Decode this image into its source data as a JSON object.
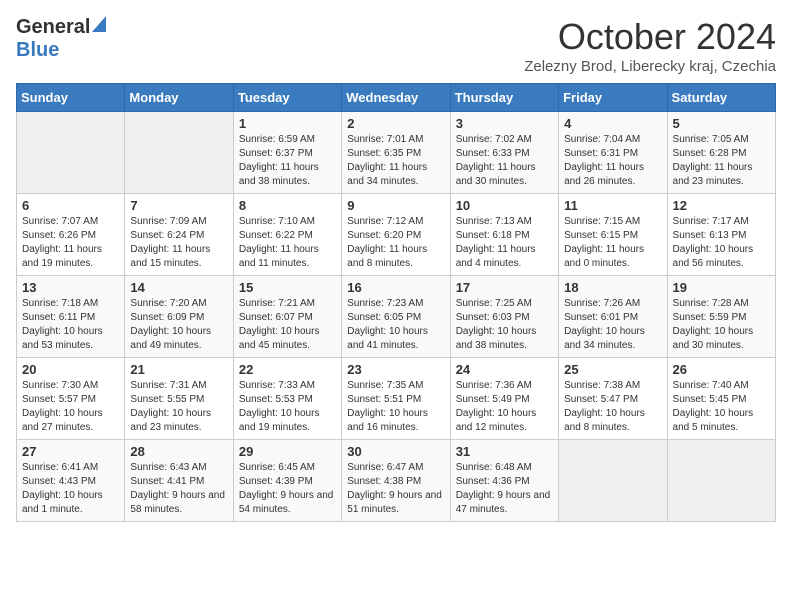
{
  "header": {
    "logo_general": "General",
    "logo_blue": "Blue",
    "month_title": "October 2024",
    "subtitle": "Zelezny Brod, Liberecky kraj, Czechia"
  },
  "days_of_week": [
    "Sunday",
    "Monday",
    "Tuesday",
    "Wednesday",
    "Thursday",
    "Friday",
    "Saturday"
  ],
  "weeks": [
    [
      {
        "day": "",
        "info": ""
      },
      {
        "day": "",
        "info": ""
      },
      {
        "day": "1",
        "info": "Sunrise: 6:59 AM\nSunset: 6:37 PM\nDaylight: 11 hours and 38 minutes."
      },
      {
        "day": "2",
        "info": "Sunrise: 7:01 AM\nSunset: 6:35 PM\nDaylight: 11 hours and 34 minutes."
      },
      {
        "day": "3",
        "info": "Sunrise: 7:02 AM\nSunset: 6:33 PM\nDaylight: 11 hours and 30 minutes."
      },
      {
        "day": "4",
        "info": "Sunrise: 7:04 AM\nSunset: 6:31 PM\nDaylight: 11 hours and 26 minutes."
      },
      {
        "day": "5",
        "info": "Sunrise: 7:05 AM\nSunset: 6:28 PM\nDaylight: 11 hours and 23 minutes."
      }
    ],
    [
      {
        "day": "6",
        "info": "Sunrise: 7:07 AM\nSunset: 6:26 PM\nDaylight: 11 hours and 19 minutes."
      },
      {
        "day": "7",
        "info": "Sunrise: 7:09 AM\nSunset: 6:24 PM\nDaylight: 11 hours and 15 minutes."
      },
      {
        "day": "8",
        "info": "Sunrise: 7:10 AM\nSunset: 6:22 PM\nDaylight: 11 hours and 11 minutes."
      },
      {
        "day": "9",
        "info": "Sunrise: 7:12 AM\nSunset: 6:20 PM\nDaylight: 11 hours and 8 minutes."
      },
      {
        "day": "10",
        "info": "Sunrise: 7:13 AM\nSunset: 6:18 PM\nDaylight: 11 hours and 4 minutes."
      },
      {
        "day": "11",
        "info": "Sunrise: 7:15 AM\nSunset: 6:15 PM\nDaylight: 11 hours and 0 minutes."
      },
      {
        "day": "12",
        "info": "Sunrise: 7:17 AM\nSunset: 6:13 PM\nDaylight: 10 hours and 56 minutes."
      }
    ],
    [
      {
        "day": "13",
        "info": "Sunrise: 7:18 AM\nSunset: 6:11 PM\nDaylight: 10 hours and 53 minutes."
      },
      {
        "day": "14",
        "info": "Sunrise: 7:20 AM\nSunset: 6:09 PM\nDaylight: 10 hours and 49 minutes."
      },
      {
        "day": "15",
        "info": "Sunrise: 7:21 AM\nSunset: 6:07 PM\nDaylight: 10 hours and 45 minutes."
      },
      {
        "day": "16",
        "info": "Sunrise: 7:23 AM\nSunset: 6:05 PM\nDaylight: 10 hours and 41 minutes."
      },
      {
        "day": "17",
        "info": "Sunrise: 7:25 AM\nSunset: 6:03 PM\nDaylight: 10 hours and 38 minutes."
      },
      {
        "day": "18",
        "info": "Sunrise: 7:26 AM\nSunset: 6:01 PM\nDaylight: 10 hours and 34 minutes."
      },
      {
        "day": "19",
        "info": "Sunrise: 7:28 AM\nSunset: 5:59 PM\nDaylight: 10 hours and 30 minutes."
      }
    ],
    [
      {
        "day": "20",
        "info": "Sunrise: 7:30 AM\nSunset: 5:57 PM\nDaylight: 10 hours and 27 minutes."
      },
      {
        "day": "21",
        "info": "Sunrise: 7:31 AM\nSunset: 5:55 PM\nDaylight: 10 hours and 23 minutes."
      },
      {
        "day": "22",
        "info": "Sunrise: 7:33 AM\nSunset: 5:53 PM\nDaylight: 10 hours and 19 minutes."
      },
      {
        "day": "23",
        "info": "Sunrise: 7:35 AM\nSunset: 5:51 PM\nDaylight: 10 hours and 16 minutes."
      },
      {
        "day": "24",
        "info": "Sunrise: 7:36 AM\nSunset: 5:49 PM\nDaylight: 10 hours and 12 minutes."
      },
      {
        "day": "25",
        "info": "Sunrise: 7:38 AM\nSunset: 5:47 PM\nDaylight: 10 hours and 8 minutes."
      },
      {
        "day": "26",
        "info": "Sunrise: 7:40 AM\nSunset: 5:45 PM\nDaylight: 10 hours and 5 minutes."
      }
    ],
    [
      {
        "day": "27",
        "info": "Sunrise: 6:41 AM\nSunset: 4:43 PM\nDaylight: 10 hours and 1 minute."
      },
      {
        "day": "28",
        "info": "Sunrise: 6:43 AM\nSunset: 4:41 PM\nDaylight: 9 hours and 58 minutes."
      },
      {
        "day": "29",
        "info": "Sunrise: 6:45 AM\nSunset: 4:39 PM\nDaylight: 9 hours and 54 minutes."
      },
      {
        "day": "30",
        "info": "Sunrise: 6:47 AM\nSunset: 4:38 PM\nDaylight: 9 hours and 51 minutes."
      },
      {
        "day": "31",
        "info": "Sunrise: 6:48 AM\nSunset: 4:36 PM\nDaylight: 9 hours and 47 minutes."
      },
      {
        "day": "",
        "info": ""
      },
      {
        "day": "",
        "info": ""
      }
    ]
  ]
}
